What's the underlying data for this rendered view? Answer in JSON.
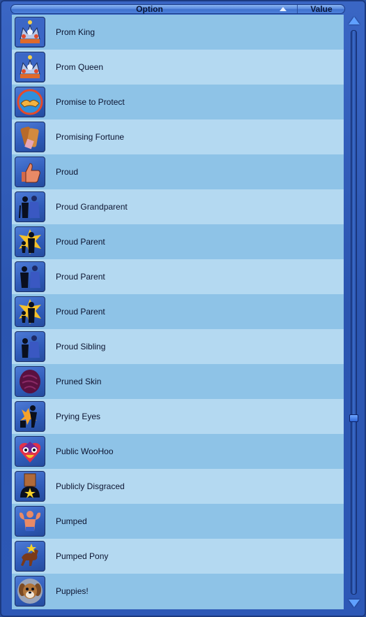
{
  "header": {
    "option_label": "Option",
    "value_label": "Value",
    "sort_icon": "sort-ascending-icon"
  },
  "scroll_position": 0.69,
  "rows": [
    {
      "label": "Prom King",
      "icon": "crown-trophy-icon"
    },
    {
      "label": "Prom Queen",
      "icon": "crown-trophy-icon"
    },
    {
      "label": "Promise to Protect",
      "icon": "handshake-shield-icon"
    },
    {
      "label": "Promising Fortune",
      "icon": "fortune-cards-icon"
    },
    {
      "label": "Proud",
      "icon": "thumbs-up-icon"
    },
    {
      "label": "Proud Grandparent",
      "icon": "grandparents-silhouette-icon"
    },
    {
      "label": "Proud Parent",
      "icon": "parent-child-star-icon"
    },
    {
      "label": "Proud Parent",
      "icon": "parents-silhouette-icon"
    },
    {
      "label": "Proud Parent",
      "icon": "parent-child-star-icon"
    },
    {
      "label": "Proud Sibling",
      "icon": "siblings-silhouette-icon"
    },
    {
      "label": "Pruned Skin",
      "icon": "wrinkled-skin-icon"
    },
    {
      "label": "Prying Eyes",
      "icon": "peeping-figure-icon"
    },
    {
      "label": "Public WooHoo",
      "icon": "heart-face-icon"
    },
    {
      "label": "Publicly Disgraced",
      "icon": "bag-head-icon"
    },
    {
      "label": "Pumped",
      "icon": "flexing-muscles-icon"
    },
    {
      "label": "Pumped Pony",
      "icon": "galloping-horse-icon"
    },
    {
      "label": "Puppies!",
      "icon": "puppy-face-icon"
    }
  ]
}
